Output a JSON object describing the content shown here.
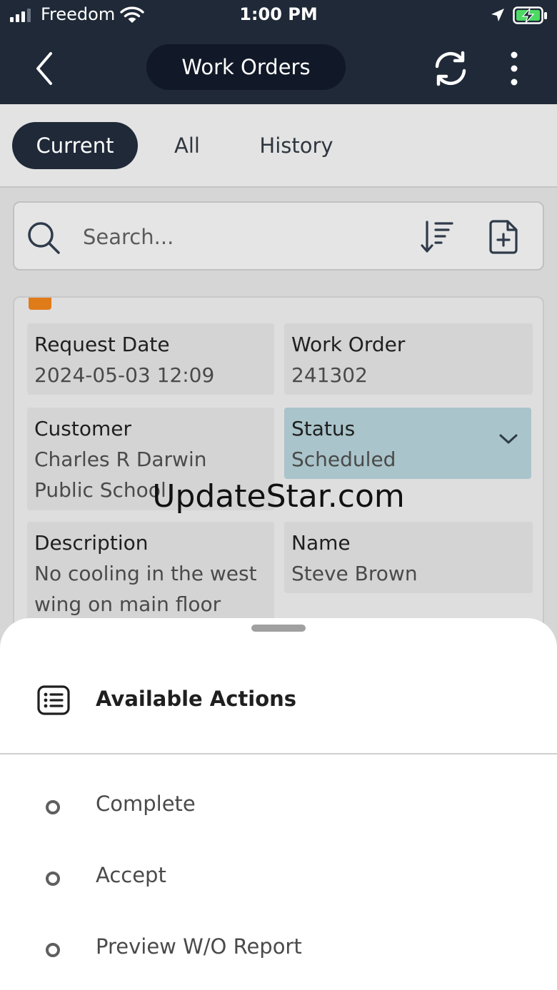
{
  "status_bar": {
    "carrier": "Freedom",
    "time": "1:00 PM"
  },
  "header": {
    "title": "Work Orders",
    "icons": [
      "chevron-left-icon",
      "sync-icon",
      "more-vertical-icon"
    ]
  },
  "tabs": [
    {
      "label": "Current",
      "active": true
    },
    {
      "label": "All",
      "active": false
    },
    {
      "label": "History",
      "active": false
    }
  ],
  "search": {
    "placeholder": "Search...",
    "value": ""
  },
  "work_order": {
    "request_date": {
      "label": "Request Date",
      "value": "2024-05-03 12:09"
    },
    "work_order": {
      "label": "Work Order",
      "value": "241302"
    },
    "customer": {
      "label": "Customer",
      "value_line1": "Charles R Darwin",
      "value_line2": "Public School"
    },
    "status": {
      "label": "Status",
      "value": "Scheduled"
    },
    "description": {
      "label": "Description",
      "value_line1": "No cooling in the west",
      "value_line2": "wing on main floor"
    },
    "name": {
      "label": "Name",
      "value": "Steve Brown"
    }
  },
  "watermark": "UpdateStar.com",
  "actions_sheet": {
    "title": "Available Actions",
    "items": [
      {
        "label": "Complete"
      },
      {
        "label": "Accept"
      },
      {
        "label": "Preview W/O Report"
      }
    ]
  },
  "colors": {
    "header_bg": "#1f2937",
    "pill_bg": "#111827",
    "status_field_bg": "#a9c4ca",
    "flag": "#e07b1a",
    "battery_charge": "#4cd964"
  }
}
